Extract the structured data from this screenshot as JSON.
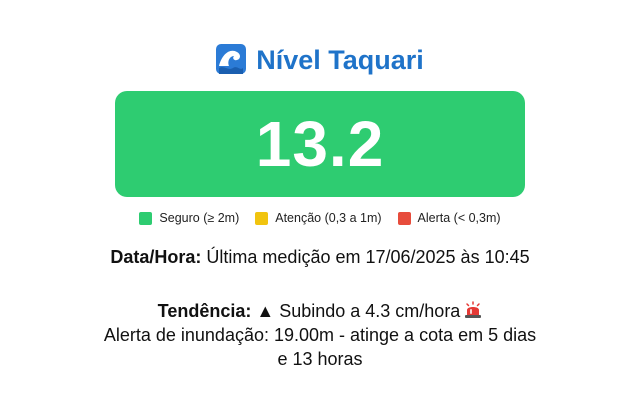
{
  "header": {
    "icon": "wave-icon",
    "title": "Nível Taquari"
  },
  "level": {
    "value": "13.2",
    "status_color": "#2ecc71"
  },
  "legend": [
    {
      "label": "Seguro (≥ 2m)",
      "color": "#2ecc71"
    },
    {
      "label": "Atenção (0,3 a 1m)",
      "color": "#f1c40f"
    },
    {
      "label": "Alerta (< 0,3m)",
      "color": "#e74c3c"
    }
  ],
  "measurement": {
    "label": "Data/Hora:",
    "text": "Última medição em 17/06/2025 às 10:45"
  },
  "trend": {
    "label": "Tendência:",
    "arrow": "▲",
    "text": "Subindo a 4.3 cm/hora",
    "icon": "alarm-light-icon",
    "alert_text": "Alerta de inundação: 19.00m - atinge a cota em 5 dias e 13 horas"
  }
}
